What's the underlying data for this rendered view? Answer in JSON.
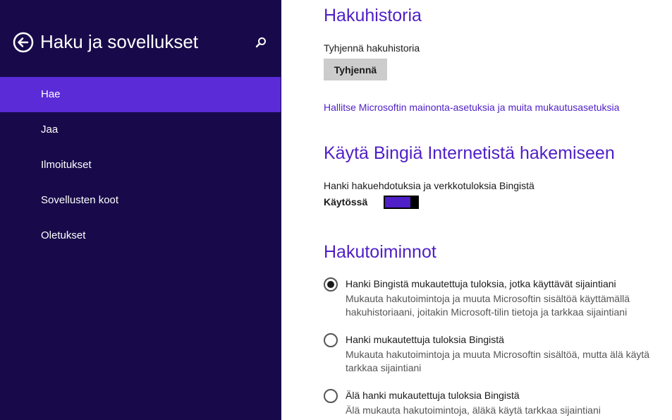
{
  "sidebar": {
    "title": "Haku ja sovellukset",
    "back_icon": "back-arrow-icon",
    "search_icon": "search-icon",
    "items": [
      {
        "label": "Hae",
        "active": true
      },
      {
        "label": "Jaa",
        "active": false
      },
      {
        "label": "Ilmoitukset",
        "active": false
      },
      {
        "label": "Sovellusten koot",
        "active": false
      },
      {
        "label": "Oletukset",
        "active": false
      }
    ]
  },
  "main": {
    "history": {
      "heading": "Hakuhistoria",
      "clear_label": "Tyhjennä hakuhistoria",
      "clear_button": "Tyhjennä",
      "ad_link": "Hallitse Microsoftin mainonta-asetuksia ja muita mukautusasetuksia"
    },
    "bing": {
      "heading": "Käytä Bingiä Internetistä hakemiseen",
      "toggle_label": "Hanki hakuehdotuksia ja verkkotuloksia Bingistä",
      "toggle_state": "Käytössä",
      "toggle_on": true
    },
    "search_features": {
      "heading": "Hakutoiminnot",
      "options": [
        {
          "title": "Hanki Bingistä mukautettuja tuloksia, jotka käyttävät sijaintiani",
          "description": "Mukauta hakutoimintoja ja muuta Microsoftin sisältöä käyttämällä hakuhistoriaani, joitakin Microsoft-tilin tietoja ja tarkkaa sijaintiani",
          "selected": true
        },
        {
          "title": "Hanki mukautettuja tuloksia Bingistä",
          "description": "Mukauta hakutoimintoja ja muuta Microsoftin sisältöä, mutta älä käytä tarkkaa sijaintiani",
          "selected": false
        },
        {
          "title": "Älä hanki mukautettuja tuloksia Bingistä",
          "description": "Älä mukauta hakutoimintoja, äläkä käytä tarkkaa sijaintiani",
          "selected": false
        }
      ]
    }
  },
  "colors": {
    "sidebar_bg": "#180a4a",
    "active_item": "#5a2bd6",
    "accent": "#4f1fc7"
  }
}
